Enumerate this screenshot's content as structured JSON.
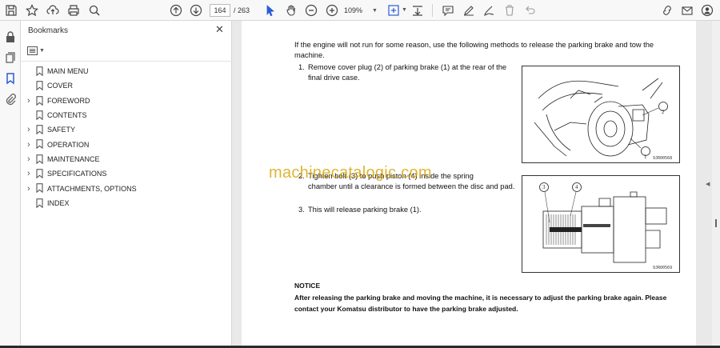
{
  "toolbar": {
    "page_current": "164",
    "page_total": "/ 263",
    "zoom": "109%"
  },
  "bookmarks": {
    "title": "Bookmarks",
    "items": [
      {
        "label": "MAIN MENU",
        "expandable": false
      },
      {
        "label": "COVER",
        "expandable": false
      },
      {
        "label": "FOREWORD",
        "expandable": true
      },
      {
        "label": "CONTENTS",
        "expandable": false
      },
      {
        "label": "SAFETY",
        "expandable": true
      },
      {
        "label": "OPERATION",
        "expandable": true
      },
      {
        "label": "MAINTENANCE",
        "expandable": true
      },
      {
        "label": "SPECIFICATIONS",
        "expandable": true
      },
      {
        "label": "ATTACHMENTS, OPTIONS",
        "expandable": true
      },
      {
        "label": "INDEX",
        "expandable": false
      }
    ]
  },
  "document": {
    "intro": "If the engine will not run for some reason, use the following methods to release the parking brake and tow the machine.",
    "step1_num": "1.",
    "step1_line1": "Remove cover plug (2) of parking brake (1) at the rear of the",
    "step1_line2": "final drive case.",
    "step2_num": "2.",
    "step2_line1": "Tighten bolt (3) to push piston (4) inside the spring",
    "step2_line2": "chamber until a clearance is formed between the disc and pad.",
    "step3_num": "3.",
    "step3_text": "This will release parking brake (1).",
    "fig1_code": "9JR00568",
    "fig2_code": "9JR00569",
    "fig1_callout_a": "2",
    "fig1_callout_b": "1",
    "fig2_callout_a": "3",
    "fig2_callout_b": "4",
    "notice_heading": "NOTICE",
    "notice_body": "After releasing the parking brake and moving the machine, it is necessary to adjust the parking brake again.  Please contact your Komatsu distributor to have the parking brake adjusted.",
    "watermark": "machinecatalogic.com"
  }
}
